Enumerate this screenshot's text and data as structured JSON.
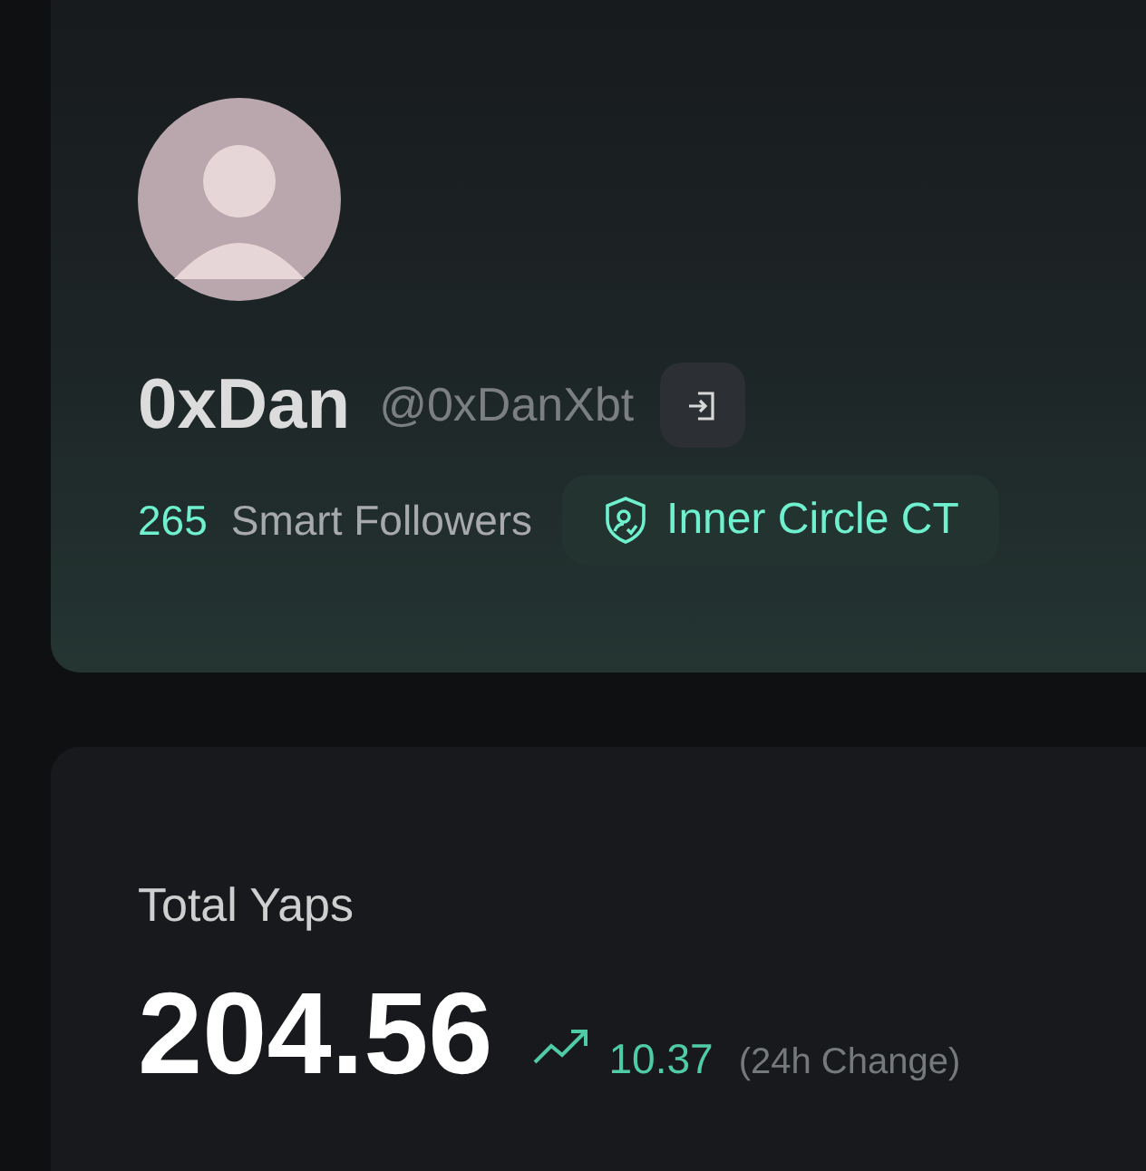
{
  "profile": {
    "name": "0xDan",
    "handle": "@0xDanXbt",
    "smart_followers_count": "265",
    "smart_followers_label": "Smart Followers",
    "badge": "Inner Circle CT"
  },
  "total_yaps": {
    "label": "Total Yaps",
    "value": "204.56",
    "change": "10.37",
    "increase": true,
    "change_period": "(24h Change)"
  }
}
